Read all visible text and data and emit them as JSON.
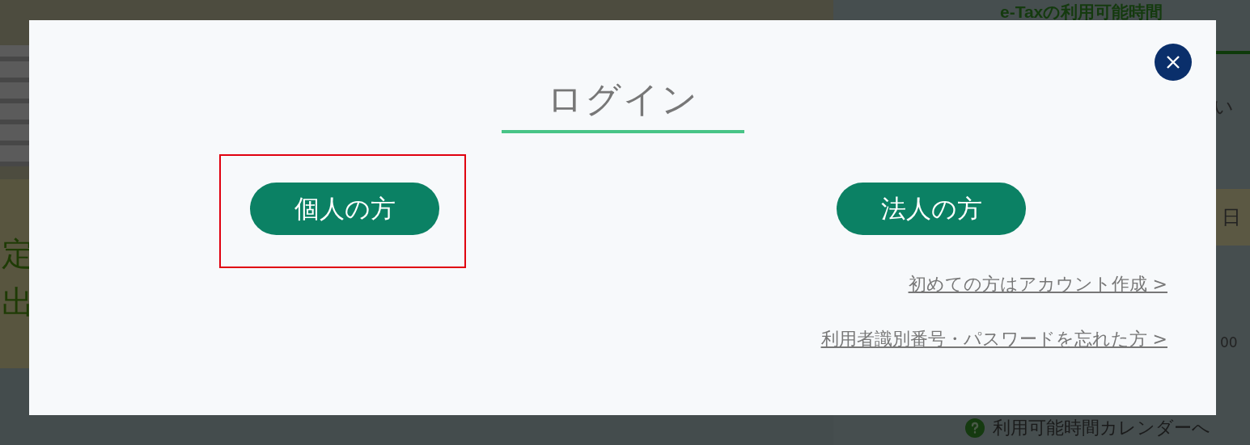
{
  "background": {
    "side_title": "e-Taxの利用可能時間",
    "left_chars": [
      "定",
      "出"
    ],
    "side_snippets": [
      "い",
      "日",
      "00"
    ],
    "calendar_link": "利用可能時間カレンダーへ"
  },
  "dialog": {
    "title": "ログイン",
    "buttons": [
      {
        "label": "個人の方",
        "highlighted": true
      },
      {
        "label": "法人の方",
        "highlighted": false
      }
    ],
    "links": [
      "初めての方はアカウント作成 >",
      "利用者識別番号・パスワードを忘れた方 >"
    ]
  }
}
